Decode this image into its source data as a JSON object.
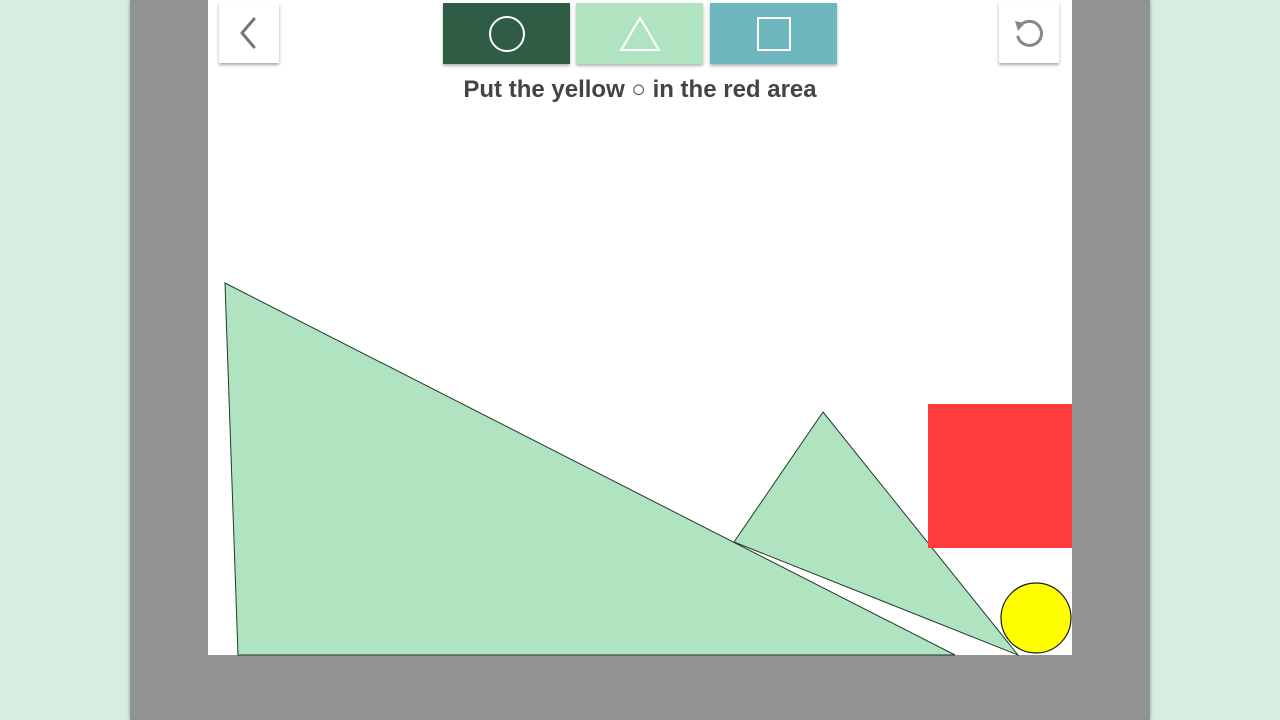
{
  "instruction": "Put the yellow ○ in the red area",
  "toolbar": {
    "back_icon": "chevron-left-icon",
    "reset_icon": "rotate-ccw-icon",
    "tools": [
      {
        "name": "circle",
        "icon": "circle-icon",
        "color": "#2f5c45"
      },
      {
        "name": "triangle",
        "icon": "triangle-icon",
        "color": "#b0e4c1"
      },
      {
        "name": "square",
        "icon": "square-icon",
        "color": "#6fb7bf"
      }
    ]
  },
  "colors": {
    "background": "#d6efe2",
    "frame": "#929292",
    "screen": "#ffffff",
    "shape_fill": "#b0e4c1",
    "target_area": "#ff3b3b",
    "ball": "#ffff00",
    "instruction_text": "#444444"
  }
}
